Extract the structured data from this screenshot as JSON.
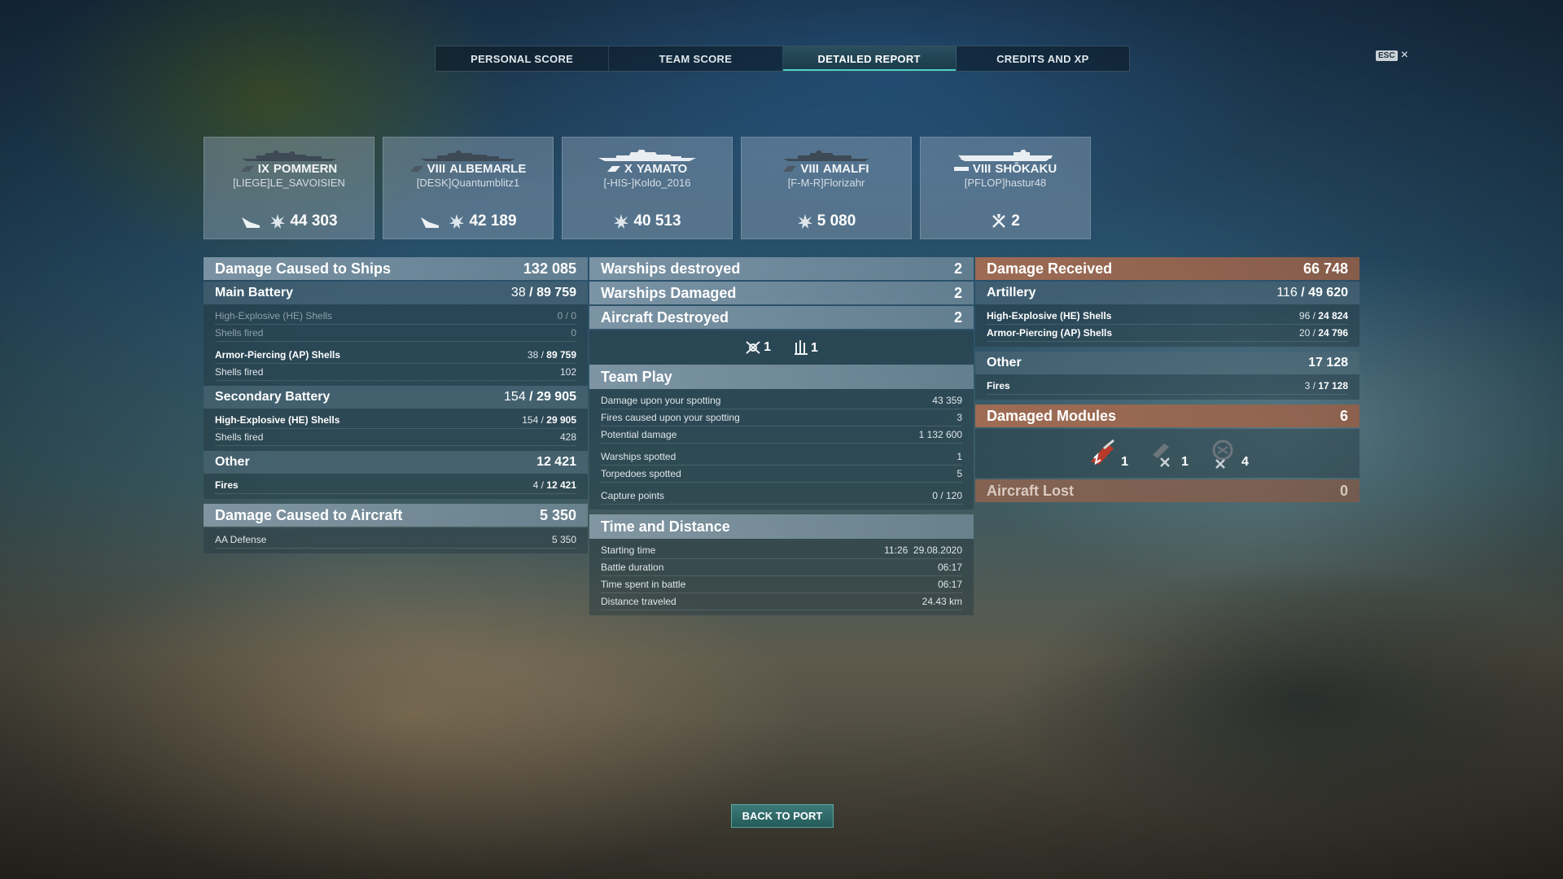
{
  "tabs": [
    {
      "label": "PERSONAL SCORE"
    },
    {
      "label": "TEAM SCORE"
    },
    {
      "label": "DETAILED REPORT",
      "active": true
    },
    {
      "label": "CREDITS AND XP"
    }
  ],
  "esc": {
    "key": "ESC",
    "close": "×"
  },
  "ships": [
    {
      "tier": "IX",
      "name": "POMMERN",
      "player": "[LIEGE]LE_SAVOISIEN",
      "class_icon": "battleship-icon",
      "stats": [
        {
          "icon": "damage-ships-icon",
          "value": ""
        },
        {
          "icon": "damage-icon",
          "value": "44 303"
        }
      ]
    },
    {
      "tier": "VIII",
      "name": "ALBEMARLE",
      "player": "[DESK]Quantumblitz1",
      "class_icon": "cruiser-icon",
      "stats": [
        {
          "icon": "damage-ships-icon",
          "value": ""
        },
        {
          "icon": "damage-icon",
          "value": "42 189"
        }
      ]
    },
    {
      "tier": "X",
      "name": "YAMATO",
      "player": "[-HIS-]Koldo_2016",
      "class_icon": "battleship-icon",
      "stats": [
        {
          "icon": "damage-icon",
          "value": "40 513"
        }
      ]
    },
    {
      "tier": "VIII",
      "name": "AMALFI",
      "player": "[F-M-R]Florizahr",
      "class_icon": "cruiser-icon",
      "stats": [
        {
          "icon": "damage-icon",
          "value": "5 080"
        }
      ]
    },
    {
      "tier": "VIII",
      "name": "SHŌKAKU",
      "player": "[PFLOP]hastur48",
      "class_icon": "carrier-icon",
      "stats": [
        {
          "icon": "planes-destroyed-icon",
          "value": "2"
        }
      ]
    }
  ],
  "left": {
    "damage_ships": {
      "label": "Damage Caused to Ships",
      "value": "132 085"
    },
    "main_battery": {
      "label": "Main Battery",
      "hits": "38",
      "value": "89 759"
    },
    "mb_rows": [
      {
        "label": "High-Explosive (HE) Shells",
        "hits": "0",
        "value": "0",
        "dim": true
      },
      {
        "label": "Shells fired",
        "value": "0",
        "dim": true
      },
      {
        "label": "Armor-Piercing (AP) Shells",
        "hits": "38",
        "value": "89 759"
      },
      {
        "label": "Shells fired",
        "value": "102"
      }
    ],
    "secondary": {
      "label": "Secondary Battery",
      "hits": "154",
      "value": "29 905"
    },
    "sec_rows": [
      {
        "label": "High-Explosive (HE) Shells",
        "hits": "154",
        "value": "29 905"
      },
      {
        "label": "Shells fired",
        "value": "428"
      }
    ],
    "other": {
      "label": "Other",
      "value": "12 421"
    },
    "other_rows": [
      {
        "label": "Fires",
        "hits": "4",
        "value": "12 421"
      }
    ],
    "damage_aircraft": {
      "label": "Damage Caused to Aircraft",
      "value": "5 350"
    },
    "aa_rows": [
      {
        "label": "AA Defense",
        "value": "5 350"
      }
    ]
  },
  "middle": {
    "destroyed": {
      "label": "Warships destroyed",
      "value": "2"
    },
    "damaged": {
      "label": "Warships Damaged",
      "value": "2"
    },
    "aircraft": {
      "label": "Aircraft Destroyed",
      "value": "2"
    },
    "aircraft_icons": [
      {
        "icon": "fighter-icon",
        "value": "1"
      },
      {
        "icon": "aa-icon",
        "value": "1"
      }
    ],
    "team_play": {
      "label": "Team Play"
    },
    "tp_rows_a": [
      {
        "label": "Damage upon your spotting",
        "value": "43 359"
      },
      {
        "label": "Fires caused upon your spotting",
        "value": "3"
      },
      {
        "label": "Potential damage",
        "value": "1 132 600"
      }
    ],
    "tp_rows_b": [
      {
        "label": "Warships spotted",
        "value": "1"
      },
      {
        "label": "Torpedoes spotted",
        "value": "5"
      }
    ],
    "tp_rows_c": [
      {
        "label": "Capture points",
        "value": "0 / 120"
      }
    ],
    "time": {
      "label": "Time and Distance"
    },
    "time_rows": [
      {
        "label": "Starting time",
        "value": "11:26  29.08.2020"
      },
      {
        "label": "Battle duration",
        "value": "06:17"
      },
      {
        "label": "Time spent in battle",
        "value": "06:17"
      },
      {
        "label": "Distance traveled",
        "value": "24.43 km"
      }
    ]
  },
  "right": {
    "received": {
      "label": "Damage Received",
      "value": "66 748"
    },
    "artillery": {
      "label": "Artillery",
      "hits": "116",
      "value": "49 620"
    },
    "art_rows": [
      {
        "label": "High-Explosive (HE) Shells",
        "hits": "96",
        "value": "24 824"
      },
      {
        "label": "Armor-Piercing (AP) Shells",
        "hits": "20",
        "value": "24 796"
      }
    ],
    "other": {
      "label": "Other",
      "value": "17 128"
    },
    "other_rows": [
      {
        "label": "Fires",
        "hits": "3",
        "value": "17 128"
      }
    ],
    "modules": {
      "label": "Damaged Modules",
      "value": "6"
    },
    "module_icons": [
      {
        "icon": "main-battery-module-icon",
        "value": "1"
      },
      {
        "icon": "secondary-module-icon",
        "value": "1"
      },
      {
        "icon": "aa-module-icon",
        "value": "4"
      }
    ],
    "aircraft_lost": {
      "label": "Aircraft Lost",
      "value": "0"
    }
  },
  "back_button": "BACK TO PORT",
  "colors": {
    "accent": "#4fd0c8",
    "received": "#aa6e52",
    "panel": "#96aab9"
  }
}
